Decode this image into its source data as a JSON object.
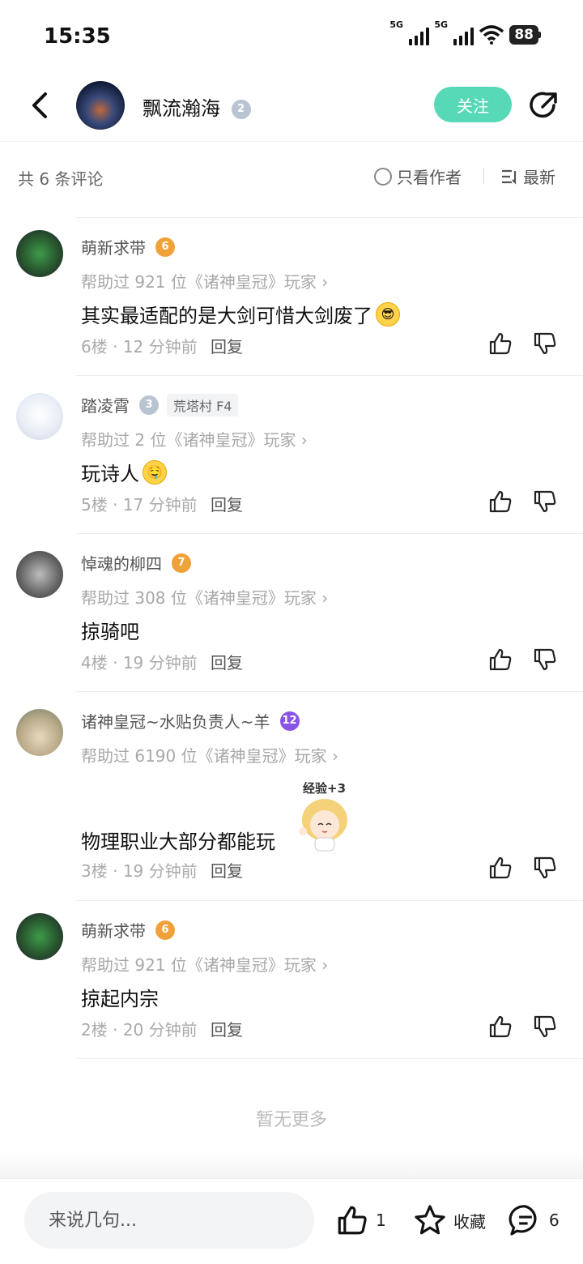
{
  "status_bar": {
    "time": "15:35",
    "network1": "5G",
    "network2": "5G",
    "battery": "88"
  },
  "header": {
    "author_name": "飘流瀚海",
    "author_level": "2",
    "follow_label": "关注"
  },
  "filter": {
    "count_text": "共 6 条评论",
    "only_author_label": "只看作者",
    "sort_label": "最新"
  },
  "comments": [
    {
      "name": "萌新求带",
      "level": "6",
      "level_color": "orange",
      "tag": "",
      "helped": "帮助过 921 位《诸神皇冠》玩家 ›",
      "text": "其实最适配的是大剑可惜大剑废了",
      "emoji": "😎",
      "floor": "6楼",
      "time": "12 分钟前",
      "reply": "回复"
    },
    {
      "name": "踏凌霄",
      "level": "3",
      "level_color": "gray",
      "tag": "荒塔村 F4",
      "helped": "帮助过 2 位《诸神皇冠》玩家 ›",
      "text": "玩诗人",
      "emoji": "🤤",
      "floor": "5楼",
      "time": "17 分钟前",
      "reply": "回复"
    },
    {
      "name": "悼魂的柳四",
      "level": "7",
      "level_color": "orange",
      "tag": "",
      "helped": "帮助过 308 位《诸神皇冠》玩家 ›",
      "text": "掠骑吧",
      "emoji": "",
      "floor": "4楼",
      "time": "19 分钟前",
      "reply": "回复"
    },
    {
      "name": "诸神皇冠~水贴负责人~羊",
      "level": "12",
      "level_color": "purple",
      "tag": "",
      "helped": "帮助过 6190 位《诸神皇冠》玩家 ›",
      "text": "物理职业大部分都能玩",
      "emoji": "",
      "sticker_text": "经验+3",
      "floor": "3楼",
      "time": "19 分钟前",
      "reply": "回复"
    },
    {
      "name": "萌新求带",
      "level": "6",
      "level_color": "orange",
      "tag": "",
      "helped": "帮助过 921 位《诸神皇冠》玩家 ›",
      "text": "掠起内宗",
      "emoji": "",
      "floor": "2楼",
      "time": "20 分钟前",
      "reply": "回复"
    }
  ],
  "no_more_text": "暂无更多",
  "bottom": {
    "input_placeholder": "来说几句...",
    "like_count": "1",
    "favorite_label": "收藏",
    "comment_count": "6"
  },
  "colors": {
    "accent": "#57d9b8",
    "level_orange": "#f0a23a",
    "level_gray": "#b9c4d3",
    "level_purple": "#8a55e6"
  }
}
